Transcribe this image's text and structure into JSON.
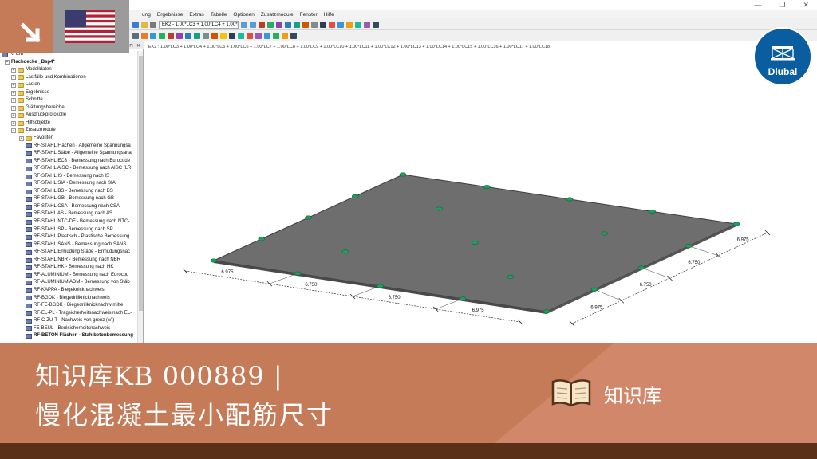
{
  "window": {
    "menu": [
      "ung",
      "Ergebnisse",
      "Extras",
      "Tabelle",
      "Optionen",
      "Zusatzmodule",
      "Fenster",
      "Hilfe"
    ],
    "combo_loadcase": "EK2 - 1.00*LC3 + 1.00*LC4 + 1.00*LC5",
    "combo_header": "EK2 : 1.00*LC3 + 1.00*LC4 + 1.00*LC5 + 1.00*LC6 + 1.00*LC7 + 1.00*LC8 + 1.00*LC9 + 1.00*LC10 + 1.00*LC11 + 1.00*LC12 + 1.00*LC13 + 1.00*LC14 + 1.00*LC15 + 1.00*LC16 + 1.00*LC17 + 1.00*LC18"
  },
  "navigator": {
    "root": "RFEM",
    "project": "Flachdecke _Bsp4*",
    "items": [
      "Modelldaten",
      "Lastfälle und Kombinationen",
      "Lasten",
      "Ergebnisse",
      "Schnitte",
      "Glättungsbereiche",
      "Ausdruckprotokolle",
      "Hilfsobjekte",
      "Zusatzmodule"
    ],
    "favorites": "Favoriten",
    "modules": [
      "RF-STAHL Flächen - Allgemeine Spannungsa",
      "RF-STAHL Stäbe - Allgemeine Spannungsana",
      "RF-STAHL EC3 - Bemessung nach Eurocode",
      "RF-STAHL AISC - Bemessung nach AISC (LRI",
      "RF-STAHL IS - Bemessung nach IS",
      "RF-STAHL SIA - Bemessung nach SIA",
      "RF-STAHL BS - Bemessung nach BS",
      "RF-STAHL GB - Bemessung nach GB",
      "RF-STAHL CSA - Bemessung nach CSA",
      "RF-STAHL AS - Bemessung nach AS",
      "RF-STAHL NTC-DF - Bemessung nach NTC-",
      "RF-STAHL SP - Bemessung nach SP",
      "RF-STAHL Plastisch - Plastische Bemessung",
      "RF-STAHL SANS - Bemessung nach SANS",
      "RF-STAHL Ermüdung Stäbe - Ermüdungsnac",
      "RF-STAHL NBR - Bemessung nach NBR",
      "RF-STAHL HK - Bemessung nach HK",
      "RF-ALUMINIUM - Bemessung nach Eurocod",
      "RF-ALUMINIUM ADM - Bemessung von Stäb",
      "RF-KAPPA - Biegeknicknachweis",
      "RF-BGDK - Biegedrillknicknachweis",
      "RF-FE-BGDK - Biegedrillknicknachw mitte",
      "RF-EL-PL - Tragsicherheitsnachweis nach EL-",
      "RF-C-ZU-T - Nachweis von grenz (c/t)",
      "FE-BEUL - Beulsicherheitsnachweis",
      "RF-BETON Flächen - Stahlbetonbemessung"
    ]
  },
  "dimensions": {
    "front": [
      "6.975",
      "6.750",
      "6.750",
      "6.975"
    ],
    "right": [
      "6.975",
      "6.750",
      "6.750",
      "6.975"
    ]
  },
  "banner": {
    "title": "知识库KB 000889 |",
    "subtitle": "慢化混凝土最小配筋尺寸",
    "kb_label": "知识库"
  },
  "brand": {
    "logo_text": "Dlubal"
  },
  "colors": {
    "banner": "#c57a58",
    "banner_dark": "#5a3019",
    "slab": "#6e6e6e",
    "support": "#1fa05a",
    "dlubal_blue": "#0a5d9e"
  }
}
